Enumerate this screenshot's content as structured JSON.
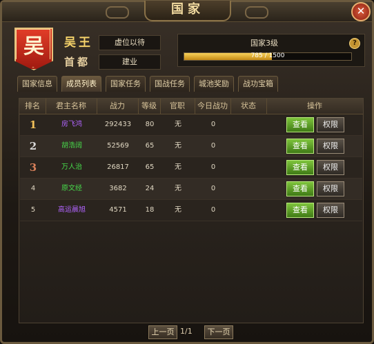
{
  "window": {
    "title": "国家",
    "close_icon": "close-icon"
  },
  "country": {
    "emblem_char": "吴",
    "king_title": "吴王",
    "ruler_value": "虚位以待",
    "capital_label": "首都",
    "capital_value": "建业",
    "level_text": "国家3级",
    "exp_text": "785 / 1500",
    "exp_fraction": 0.523
  },
  "tabs": [
    {
      "label": "国家信息",
      "active": false
    },
    {
      "label": "成员列表",
      "active": true
    },
    {
      "label": "国家任务",
      "active": false
    },
    {
      "label": "国战任务",
      "active": false
    },
    {
      "label": "城池奖励",
      "active": false
    },
    {
      "label": "战功宝箱",
      "active": false
    }
  ],
  "table": {
    "headers": [
      "排名",
      "君主名称",
      "战力",
      "等级",
      "官职",
      "今日战功",
      "状态",
      "操作"
    ],
    "rows": [
      {
        "rank": "1",
        "name": "房飞鸿",
        "power": "292433",
        "level": "80",
        "office": "无",
        "merit": "0",
        "status": "",
        "name_color": "#b164ff",
        "rank_color": "#f2c15a"
      },
      {
        "rank": "2",
        "name": "胡浩阔",
        "power": "52569",
        "level": "65",
        "office": "无",
        "merit": "0",
        "status": "",
        "name_color": "#47d84a",
        "rank_color": "#d8d8d8"
      },
      {
        "rank": "3",
        "name": "万人治",
        "power": "26817",
        "level": "65",
        "office": "无",
        "merit": "0",
        "status": "",
        "name_color": "#47d84a",
        "rank_color": "#d9805a"
      },
      {
        "rank": "4",
        "name": "原文经",
        "power": "3682",
        "level": "24",
        "office": "无",
        "merit": "0",
        "status": "",
        "name_color": "#47d84a",
        "rank_color": "#e0d7c2"
      },
      {
        "rank": "5",
        "name": "高运晨旭",
        "power": "4571",
        "level": "18",
        "office": "无",
        "merit": "0",
        "status": "",
        "name_color": "#b164ff",
        "rank_color": "#e0d7c2"
      }
    ],
    "view_label": "查看",
    "perm_label": "权限"
  },
  "pagination": {
    "prev": "上一页",
    "page": "1/1",
    "next": "下一页"
  }
}
